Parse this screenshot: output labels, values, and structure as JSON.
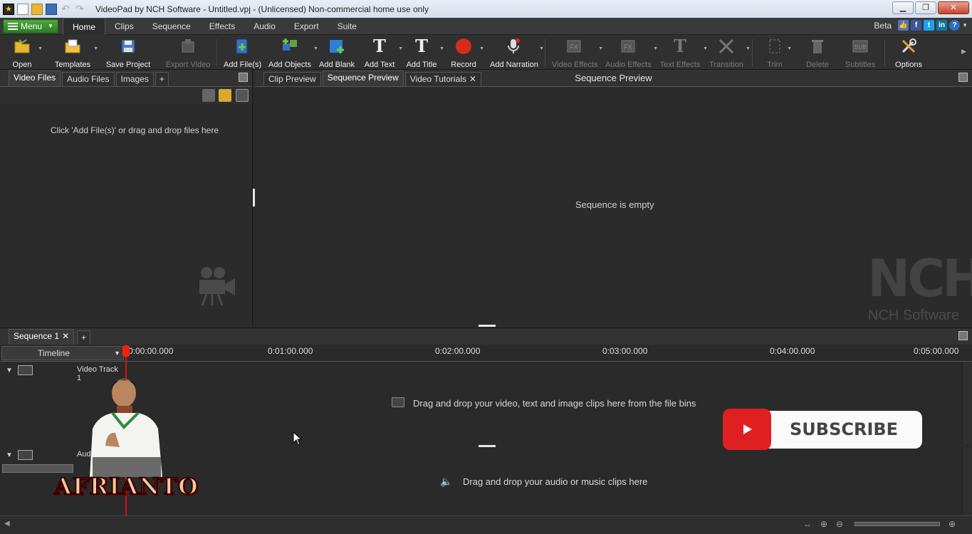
{
  "window": {
    "title": "VideoPad by NCH Software - Untitled.vpj - (Unlicensed) Non-commercial home use only"
  },
  "menubar": {
    "menu_label": "Menu",
    "tabs": [
      "Home",
      "Clips",
      "Sequence",
      "Effects",
      "Audio",
      "Export",
      "Suite"
    ],
    "active_tab": "Home",
    "beta_label": "Beta"
  },
  "toolbar": {
    "open": "Open",
    "templates": "Templates",
    "save_project": "Save Project",
    "export_video": "Export Video",
    "add_files": "Add File(s)",
    "add_objects": "Add Objects",
    "add_blank": "Add Blank",
    "add_text": "Add Text",
    "add_title": "Add Title",
    "record": "Record",
    "add_narration": "Add Narration",
    "video_effects": "Video Effects",
    "audio_effects": "Audio Effects",
    "text_effects": "Text Effects",
    "transition": "Transition",
    "trim": "Trim",
    "delete": "Delete",
    "subtitles": "Subtitles",
    "options": "Options"
  },
  "left_panel": {
    "tabs": [
      "Video Files",
      "Audio Files",
      "Images",
      "+"
    ],
    "empty_message": "Click 'Add File(s)' or drag and drop files here"
  },
  "preview": {
    "tabs": [
      "Clip Preview",
      "Sequence Preview",
      "Video Tutorials"
    ],
    "title": "Sequence Preview",
    "empty_message": "Sequence is empty",
    "watermark": "NCH",
    "watermark_sub": "NCH Software"
  },
  "sequence": {
    "tab": "Sequence 1",
    "add": "+",
    "timeline_mode": "Timeline",
    "ticks": [
      "0:00:00.000",
      "0:01:00.000",
      "0:02:00.000",
      "0:03:00.000",
      "0:04:00.000",
      "0:05:00.000"
    ],
    "video_track": "Video Track 1",
    "audio_track": "Audi",
    "video_drop": "Drag and drop your video, text and image clips here from the file bins",
    "audio_drop": "Drag and drop your audio or music clips here"
  },
  "overlay": {
    "subscribe": "SUBSCRIBE",
    "name": "AFRIANTO"
  },
  "colors": {
    "menu_green": "#3a9530",
    "record_red": "#d62b1e",
    "playhead": "#dd1111",
    "youtube_red": "#e02020"
  }
}
